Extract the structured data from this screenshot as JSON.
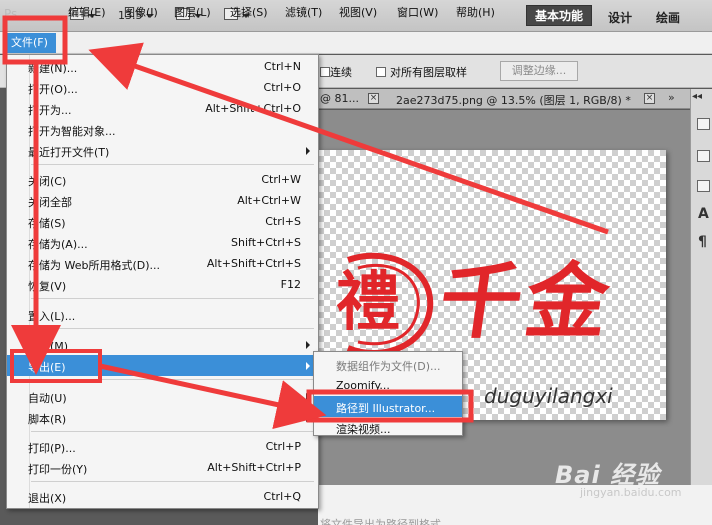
{
  "app": {
    "logo_text": "Ps",
    "zoom": "13.5",
    "workspaces": [
      "基本功能",
      "设计",
      "绘画"
    ]
  },
  "menubar": {
    "items": [
      "文件(F)",
      "编辑(E)",
      "图像(I)",
      "图层(L)",
      "选择(S)",
      "滤镜(T)",
      "视图(V)",
      "窗口(W)",
      "帮助(H)"
    ]
  },
  "options": {
    "contiguous_label": "连续",
    "sample_all_layers_label": "对所有图层取样",
    "refine_edge_label": "调整边缘..."
  },
  "tabs": {
    "tab1": "@ 81...",
    "tab2": "2ae273d75.png @ 13.5% (图层 1, RGB/8) *",
    "more": "»"
  },
  "canvas": {
    "seal_char": "禮",
    "title_chars": "千金",
    "watermark_text": "duguyilangxi"
  },
  "right_panel": {
    "toggle": "◂◂",
    "a_label": "A",
    "p_label": "¶"
  },
  "file_menu": {
    "items": [
      {
        "label": "新建(N)...",
        "shortcut": "Ctrl+N"
      },
      {
        "label": "打开(O)...",
        "shortcut": "Ctrl+O"
      },
      {
        "label": "打开为...",
        "shortcut": "Alt+Shift+Ctrl+O"
      },
      {
        "label": "打开为智能对象...",
        "shortcut": ""
      },
      {
        "label": "最近打开文件(T)",
        "shortcut": ""
      },
      {
        "label": "关闭(C)",
        "shortcut": "Ctrl+W"
      },
      {
        "label": "关闭全部",
        "shortcut": "Alt+Ctrl+W"
      },
      {
        "label": "存储(S)",
        "shortcut": "Ctrl+S"
      },
      {
        "label": "存储为(A)...",
        "shortcut": "Shift+Ctrl+S"
      },
      {
        "label": "存储为 Web所用格式(D)...",
        "shortcut": "Alt+Shift+Ctrl+S"
      },
      {
        "label": "恢复(V)",
        "shortcut": "F12"
      },
      {
        "label": "置入(L)...",
        "shortcut": ""
      },
      {
        "label": "导入(M)",
        "shortcut": ""
      },
      {
        "label": "导出(E)",
        "shortcut": ""
      },
      {
        "label": "自动(U)",
        "shortcut": ""
      },
      {
        "label": "脚本(R)",
        "shortcut": ""
      },
      {
        "label": "打印(P)...",
        "shortcut": "Ctrl+P"
      },
      {
        "label": "打印一份(Y)",
        "shortcut": "Alt+Shift+Ctrl+P"
      },
      {
        "label": "退出(X)",
        "shortcut": "Ctrl+Q"
      }
    ]
  },
  "export_submenu": {
    "items": [
      "数据组作为文件(D)...",
      "Zoomify...",
      "路径到 Illustrator...",
      "渲染视频..."
    ]
  },
  "watermark": {
    "logo": "Bai 经验",
    "url": "jingyan.baidu.com"
  },
  "bottom": {
    "caption": "将文件导出为路径到格式"
  },
  "colors": {
    "highlight": "#3b8fd8",
    "annotation_red": "#ef3b3b",
    "logo_red": "#e1262a"
  }
}
